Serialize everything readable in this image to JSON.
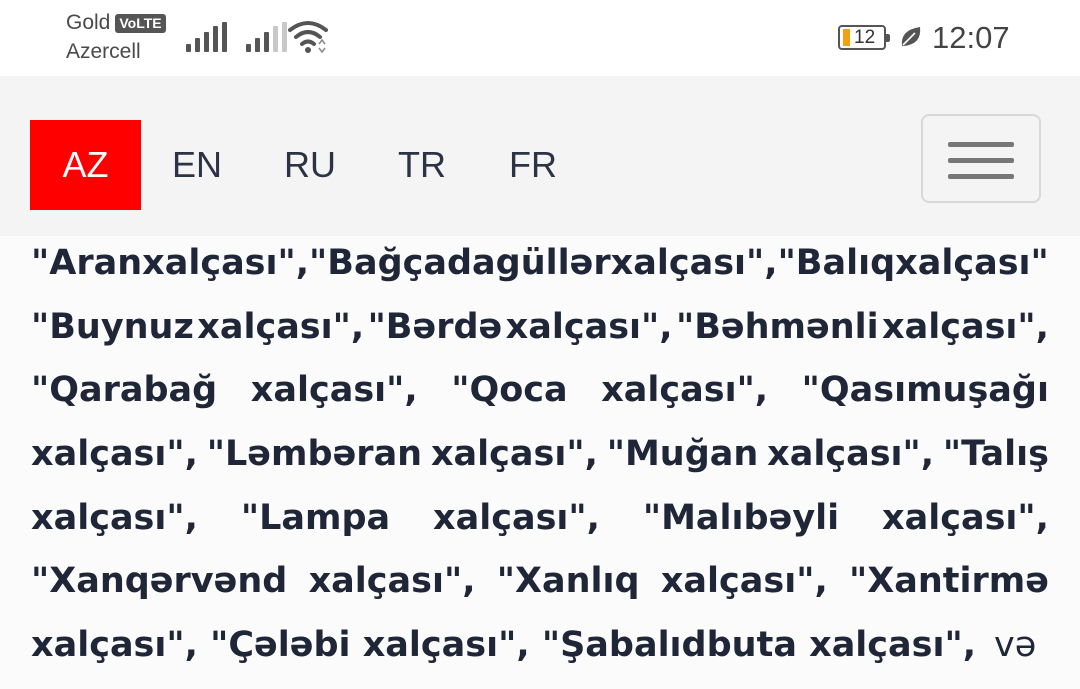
{
  "status_bar": {
    "carrier_name": "Gold",
    "volte_label": "VoLTE",
    "carrier_line2": "Azercell",
    "battery_level": "12",
    "time": "12:07"
  },
  "header": {
    "languages": [
      {
        "code": "AZ",
        "active": true
      },
      {
        "code": "EN",
        "active": false
      },
      {
        "code": "RU",
        "active": false
      },
      {
        "code": "TR",
        "active": false
      },
      {
        "code": "FR",
        "active": false
      }
    ],
    "menu_icon": "hamburger-icon",
    "accent_color": "#ff0000"
  },
  "article": {
    "lines": [
      "\"Aran xalçası\", \"Bağçadagüllər xalçası\", \"Balıq xalçası\",",
      "\"Buynuz xalçası\", \"Bərdə xalçası\", \"Bəhmənli xalçası\",",
      "\"Qarabağ xalçası\", \"Qoca xalçası\", \"Qasımuşağı",
      "xalçası\", \"Ləmbəran xalçası\", \"Muğan xalçası\", \"Talış",
      "xalçası\", \"Lampa xalçası\", \"Malıbəyli xalçası\",",
      "\"Xanqərvənd xalçası\", \"Xanlıq xalçası\", \"Xantirmə",
      "xalçası\", \"Çələbi xalçası\", \"Şabalıdbuta xalçası\","
    ],
    "last_line_tail": "və s."
  }
}
